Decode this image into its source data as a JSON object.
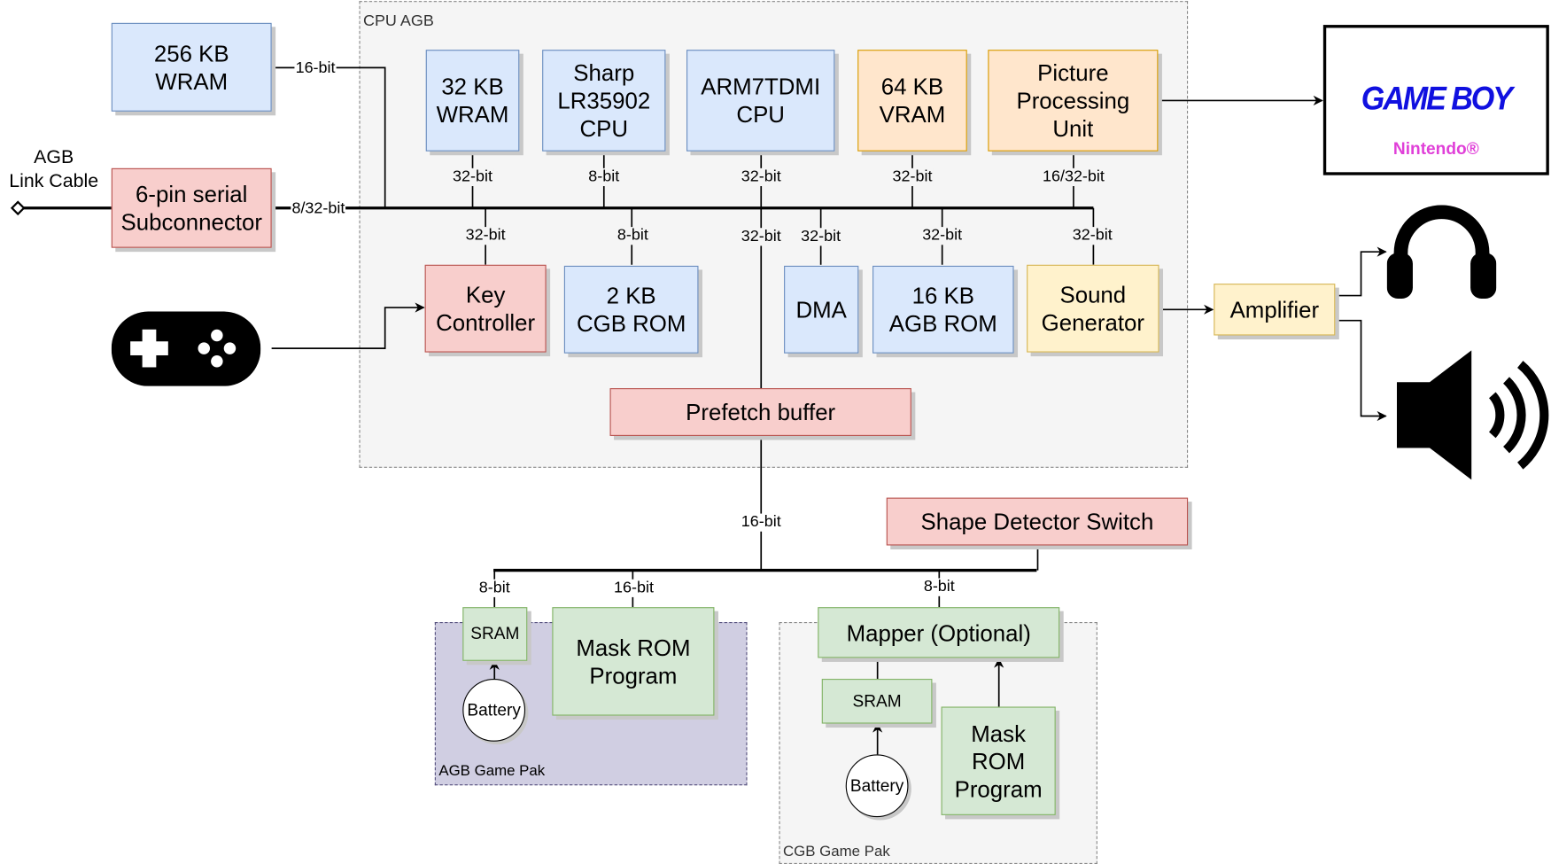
{
  "groups": {
    "cpu_agb": "CPU AGB",
    "agb_game_pak": "AGB Game Pak",
    "cgb_game_pak": "CGB Game Pak"
  },
  "external": {
    "wram_256": "256 KB\nWRAM",
    "link_cable": "AGB\nLink Cable",
    "subconnector": "6-pin serial\nSubconnector",
    "amplifier": "Amplifier",
    "shape_switch": "Shape Detector Switch",
    "display_title": "GAME BOY",
    "display_sub": "Nintendo®"
  },
  "cpu": {
    "wram_32": "32 KB\nWRAM",
    "sharp_cpu": "Sharp\nLR35902\nCPU",
    "arm_cpu": "ARM7TDMI\nCPU",
    "vram": "64 KB\nVRAM",
    "ppu": "Picture\nProcessing\nUnit",
    "key_controller": "Key\nController",
    "cgb_rom": "2 KB\nCGB ROM",
    "dma": "DMA",
    "agb_rom": "16 KB\nAGB ROM",
    "sound": "Sound\nGenerator",
    "prefetch": "Prefetch buffer"
  },
  "agb_pak": {
    "sram": "SRAM",
    "battery": "Battery",
    "mask_rom": "Mask ROM\nProgram"
  },
  "cgb_pak": {
    "mapper": "Mapper (Optional)",
    "sram": "SRAM",
    "battery": "Battery",
    "mask_rom": "Mask\nROM\nProgram"
  },
  "bus_labels": {
    "wram256": "16-bit",
    "subconnector": "8/32-bit",
    "wram32": "32-bit",
    "sharp": "8-bit",
    "arm": "32-bit",
    "vram": "32-bit",
    "ppu": "16/32-bit",
    "key": "32-bit",
    "cgbrom": "8-bit",
    "prefetch": "32-bit",
    "dma": "32-bit",
    "agbrom": "32-bit",
    "sound": "32-bit",
    "cart_bus": "16-bit",
    "agb_sram": "8-bit",
    "agb_mask": "16-bit",
    "cgb_mapper": "8-bit"
  },
  "icons": [
    "gamepad-icon",
    "headphones-icon",
    "speaker-icon"
  ]
}
